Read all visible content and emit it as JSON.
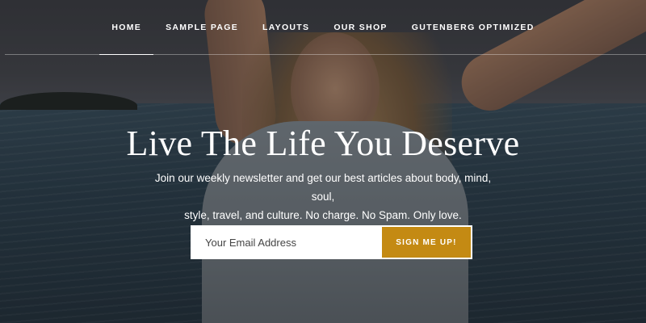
{
  "nav": {
    "items": [
      {
        "label": "HOME",
        "active": true
      },
      {
        "label": "SAMPLE PAGE",
        "active": false
      },
      {
        "label": "LAYOUTS",
        "active": false
      },
      {
        "label": "OUR SHOP",
        "active": false
      },
      {
        "label": "GUTENBERG OPTIMIZED",
        "active": false
      }
    ]
  },
  "hero": {
    "title": "Live The Life You Deserve",
    "subtitle_line1": "Join our weekly newsletter and get our best articles about body, mind, soul,",
    "subtitle_line2": "style, travel, and culture. No charge. No Spam. Only love."
  },
  "signup": {
    "placeholder": "Your Email Address",
    "button_label": "SIGN ME UP!",
    "button_color": "#c48a13"
  }
}
